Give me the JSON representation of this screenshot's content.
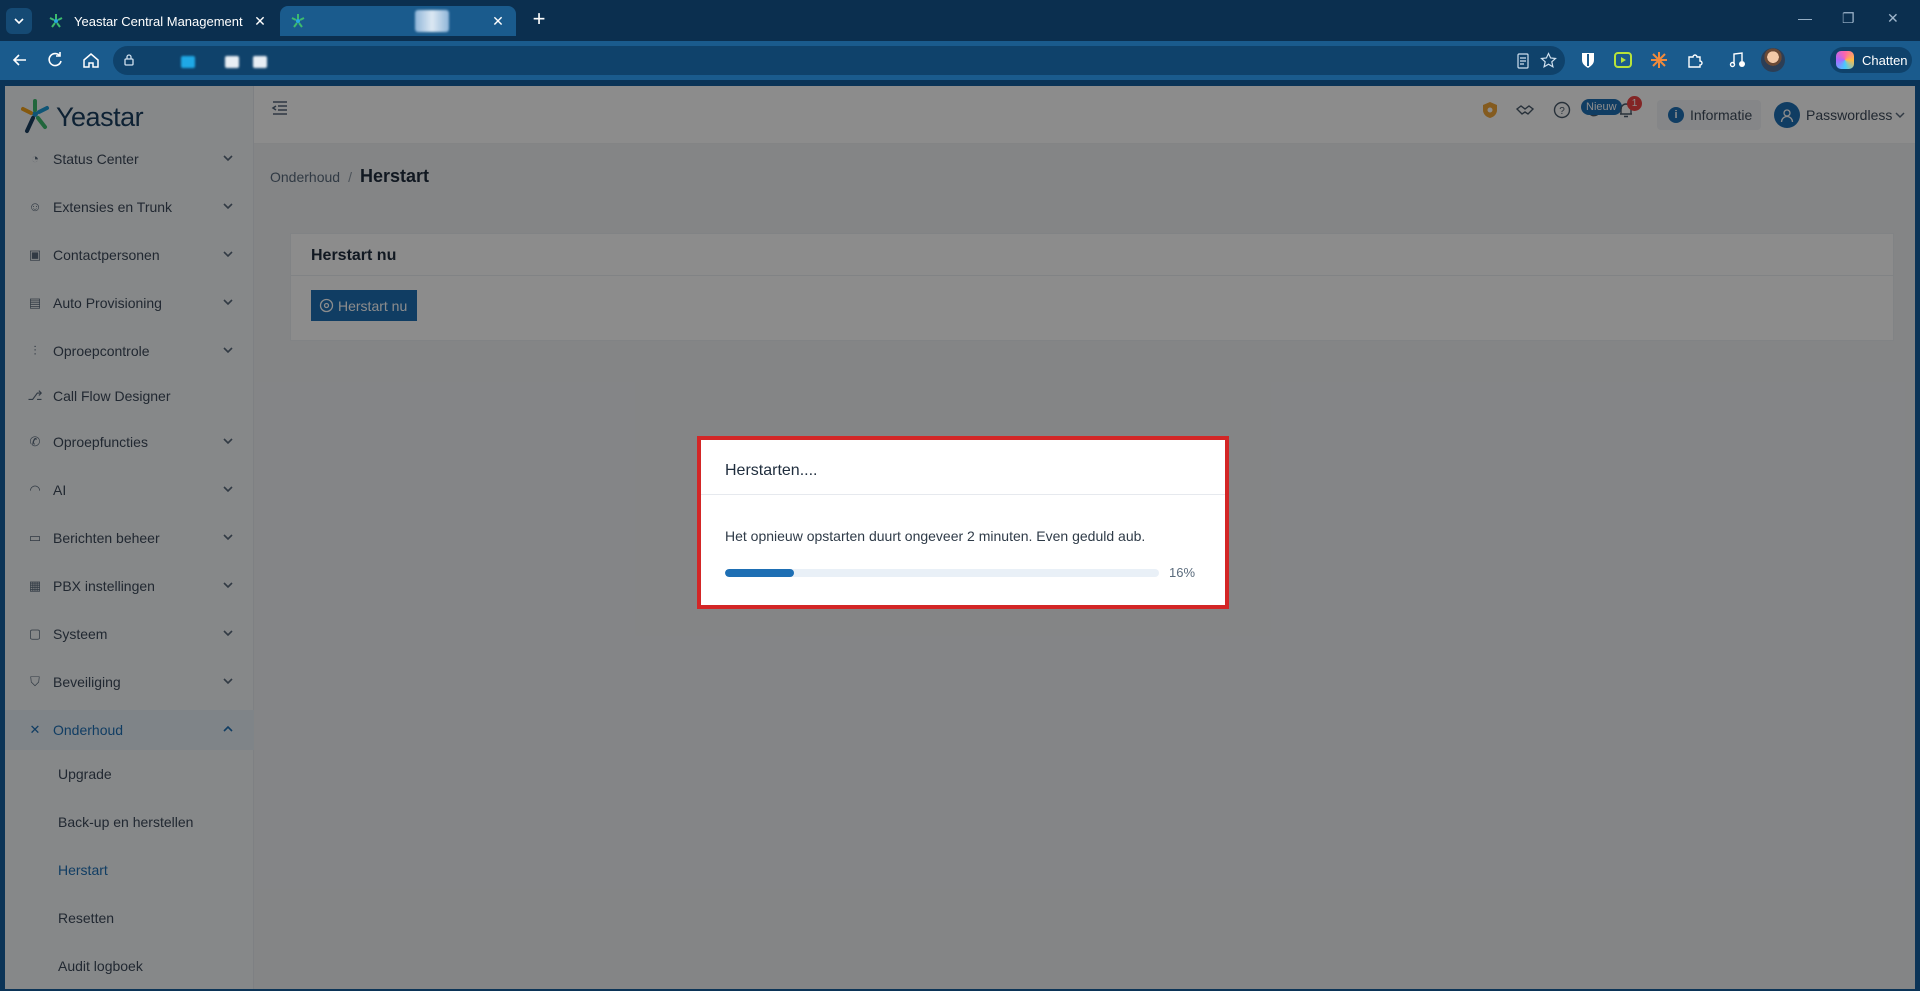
{
  "browser": {
    "tabs": [
      {
        "title": "Yeastar Central Management"
      },
      {
        "title": ""
      }
    ],
    "chat_label": "Chatten"
  },
  "app": {
    "brand": "Yeastar",
    "menu": [
      {
        "label": "Status Center",
        "icon": "dashboard-icon"
      },
      {
        "label": "Extensies en Trunk",
        "icon": "users-icon"
      },
      {
        "label": "Contactpersonen",
        "icon": "contacts-icon"
      },
      {
        "label": "Auto Provisioning",
        "icon": "provisioning-icon"
      },
      {
        "label": "Oproepcontrole",
        "icon": "sliders-icon"
      },
      {
        "label": "Call Flow Designer",
        "icon": "flow-icon"
      },
      {
        "label": "Oproepfuncties",
        "icon": "phone-icon"
      },
      {
        "label": "AI",
        "icon": "headset-icon"
      },
      {
        "label": "Berichten beheer",
        "icon": "message-icon"
      },
      {
        "label": "PBX instellingen",
        "icon": "settings-grid-icon"
      },
      {
        "label": "Systeem",
        "icon": "monitor-icon"
      },
      {
        "label": "Beveiliging",
        "icon": "shield-icon"
      },
      {
        "label": "Onderhoud",
        "icon": "tools-icon"
      }
    ],
    "submenu": [
      {
        "label": "Upgrade"
      },
      {
        "label": "Back-up en herstellen"
      },
      {
        "label": "Herstart"
      },
      {
        "label": "Resetten"
      },
      {
        "label": "Audit logboek"
      }
    ],
    "topbar": {
      "new_badge": "Nieuw",
      "notification_count": "1",
      "info_label": "Informatie",
      "user_label": "Passwordless"
    },
    "breadcrumb": {
      "parent": "Onderhoud",
      "separator": "/",
      "current": "Herstart"
    },
    "card": {
      "title": "Herstart nu",
      "button_label": "Herstart nu"
    },
    "modal": {
      "title": "Herstarten....",
      "message": "Het opnieuw opstarten duurt ongeveer 2 minuten. Even geduld aub.",
      "progress_percent": 16,
      "progress_label": "16%"
    }
  },
  "colors": {
    "accent": "#1e6fb4",
    "highlight_border": "#d32626",
    "browser_frame": "#1a5b8d"
  }
}
